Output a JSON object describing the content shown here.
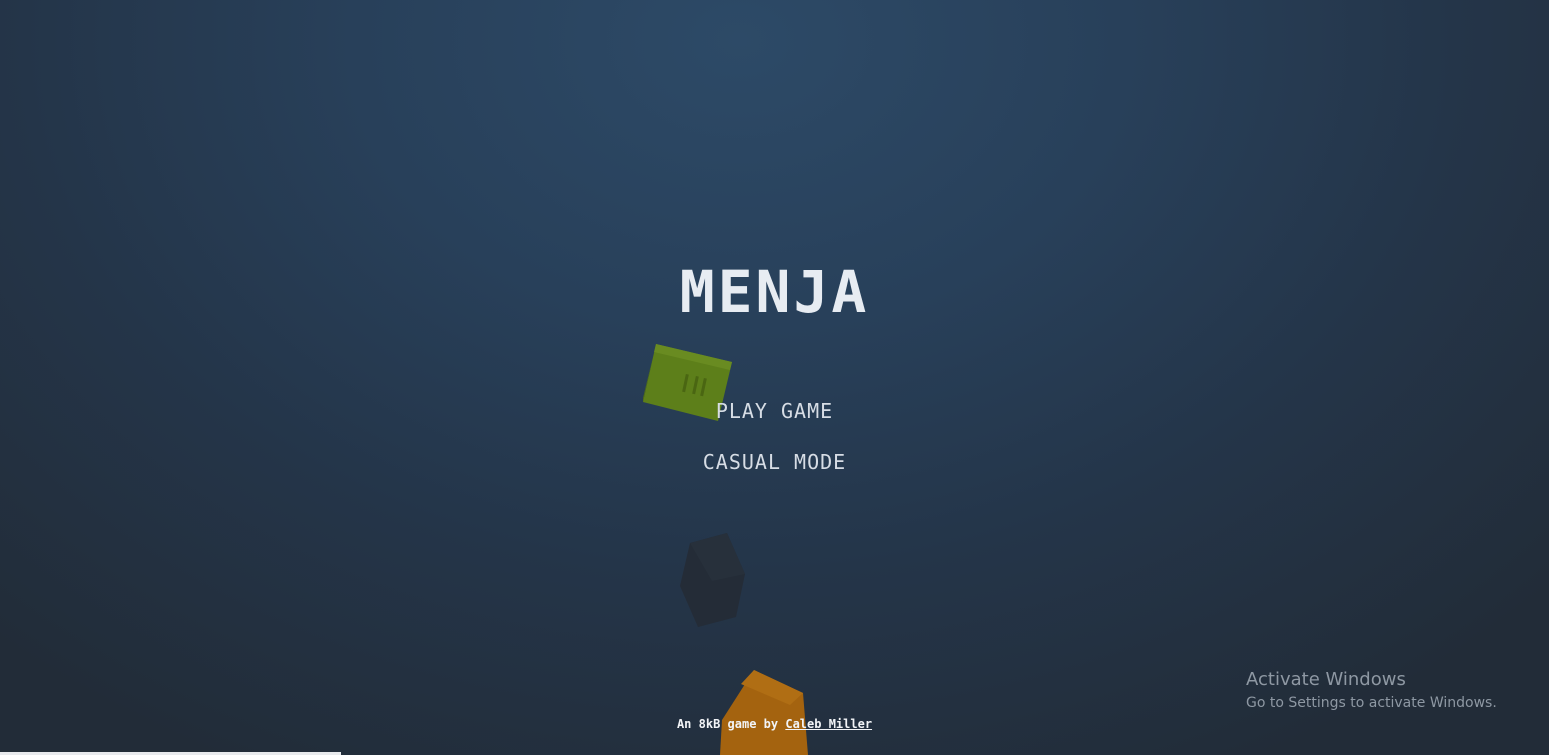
{
  "game": {
    "title": "MENJA",
    "menu": {
      "play_label": "PLAY GAME",
      "casual_label": "CASUAL MODE"
    },
    "credit": {
      "prefix": "An 8kB game by",
      "author": "Caleb Miller"
    },
    "loading_progress_percent": 22
  },
  "background_cubes": [
    {
      "name": "green-cube",
      "color": "#5d7f1a"
    },
    {
      "name": "dark-cube",
      "color": "#242c37"
    },
    {
      "name": "orange-cube",
      "color": "#a4630f"
    }
  ],
  "os_watermark": {
    "title": "Activate Windows",
    "subtitle": "Go to Settings to activate Windows."
  }
}
